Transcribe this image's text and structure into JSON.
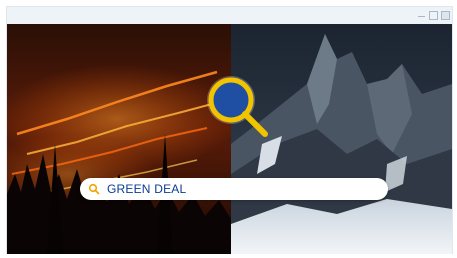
{
  "window": {
    "controls": [
      "minimize-icon",
      "maximize-icon",
      "close-icon"
    ]
  },
  "search": {
    "query": "GREEN DEAL",
    "icon": "search-icon"
  },
  "overlay": {
    "icon": "magnifying-glass-icon",
    "ring_color": "#f2c400",
    "lens_color": "#1f4fa3"
  },
  "colors": {
    "accent_yellow": "#f2c400",
    "eu_blue": "#0b3d91",
    "fire_orange": "#e8671b"
  }
}
